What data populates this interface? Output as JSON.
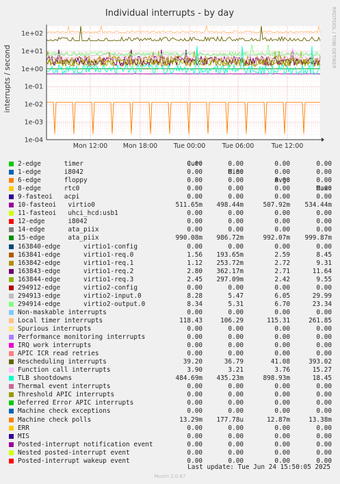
{
  "chart_data": {
    "type": "line",
    "title": "Individual interrupts - by day",
    "ylabel": "interrupts / second",
    "yscale": "log",
    "ylim": [
      0.0001,
      300
    ],
    "y_ticks": [
      "1e+02",
      "1e+01",
      "1e+00",
      "1e-01",
      "1e-02",
      "1e-03",
      "1e-04"
    ],
    "x_ticks": [
      "Mon 12:00",
      "Mon 18:00",
      "Tue 00:00",
      "Tue 06:00",
      "Tue 12:00"
    ],
    "side_label": "RRDTOOL / TOBI OETIKER",
    "columns": [
      "Cur:",
      "Min:",
      "Avg:",
      "Max:"
    ],
    "series": [
      {
        "name": "2-edge      timer",
        "color": "#00cc00",
        "values": [
          "0.00",
          "0.00",
          "0.00",
          "0.00"
        ]
      },
      {
        "name": "1-edge      i8042",
        "color": "#0066b3",
        "values": [
          "0.00",
          "0.00",
          "0.00",
          "0.00"
        ]
      },
      {
        "name": "6-edge      floppy",
        "color": "#ff8000",
        "values": [
          "0.00",
          "0.00",
          "0.00",
          "0.00"
        ]
      },
      {
        "name": "8-edge      rtc0",
        "color": "#ffcc00",
        "values": [
          "0.00",
          "0.00",
          "0.00",
          "0.00"
        ]
      },
      {
        "name": "9-fasteoi   acpi",
        "color": "#330099",
        "values": [
          "0.00",
          "0.00",
          "0.00",
          "0.00"
        ]
      },
      {
        "name": "10-fasteoi   virtio0",
        "color": "#990099",
        "values": [
          "511.65m",
          "498.44m",
          "507.92m",
          "534.44m"
        ]
      },
      {
        "name": "11-fasteoi   uhci_hcd:usb1",
        "color": "#ccff00",
        "values": [
          "0.00",
          "0.00",
          "0.00",
          "0.00"
        ]
      },
      {
        "name": "12-edge      i8042",
        "color": "#ff0000",
        "values": [
          "0.00",
          "0.00",
          "0.00",
          "0.00"
        ]
      },
      {
        "name": "14-edge      ata_piix",
        "color": "#808080",
        "values": [
          "0.00",
          "0.00",
          "0.00",
          "0.00"
        ]
      },
      {
        "name": "15-edge      ata_piix",
        "color": "#008f00",
        "values": [
          "990.08m",
          "986.72m",
          "992.07m",
          "999.87m"
        ]
      },
      {
        "name": "163840-edge      virtio1-config",
        "color": "#00487d",
        "values": [
          "0.00",
          "0.00",
          "0.00",
          "0.00"
        ]
      },
      {
        "name": "163841-edge      virtio1-req.0",
        "color": "#b35a00",
        "values": [
          "1.56",
          "193.65m",
          "2.59",
          "8.45"
        ]
      },
      {
        "name": "163842-edge      virtio1-req.1",
        "color": "#b38f00",
        "values": [
          "1.12",
          "253.72m",
          "2.72",
          "9.31"
        ]
      },
      {
        "name": "163843-edge      virtio1-req.2",
        "color": "#6b006b",
        "values": [
          "2.80",
          "362.17m",
          "2.71",
          "11.64"
        ]
      },
      {
        "name": "163844-edge      virtio1-req.3",
        "color": "#8fb300",
        "values": [
          "2.45",
          "297.09m",
          "2.42",
          "9.55"
        ]
      },
      {
        "name": "294912-edge      virtio2-config",
        "color": "#b30000",
        "values": [
          "0.00",
          "0.00",
          "0.00",
          "0.00"
        ]
      },
      {
        "name": "294913-edge      virtio2-input.0",
        "color": "#bebebe",
        "values": [
          "8.28",
          "5.47",
          "6.05",
          "29.99"
        ]
      },
      {
        "name": "294914-edge      virtio2-output.0",
        "color": "#80ff80",
        "values": [
          "8.34",
          "5.31",
          "6.70",
          "23.34"
        ]
      },
      {
        "name": "Non-maskable interrupts",
        "color": "#80c9ff",
        "values": [
          "0.00",
          "0.00",
          "0.00",
          "0.00"
        ]
      },
      {
        "name": "Local timer interrupts",
        "color": "#ffc080",
        "values": [
          "118.43",
          "106.29",
          "115.31",
          "261.85"
        ]
      },
      {
        "name": "Spurious interrupts",
        "color": "#ffe680",
        "values": [
          "0.00",
          "0.00",
          "0.00",
          "0.00"
        ]
      },
      {
        "name": "Performance monitoring interrupts",
        "color": "#aa80ff",
        "values": [
          "0.00",
          "0.00",
          "0.00",
          "0.00"
        ]
      },
      {
        "name": "IRQ work interrupts",
        "color": "#ee00cc",
        "values": [
          "0.00",
          "0.00",
          "0.00",
          "0.00"
        ]
      },
      {
        "name": "APIC ICR read retries",
        "color": "#ff8080",
        "values": [
          "0.00",
          "0.00",
          "0.00",
          "0.00"
        ]
      },
      {
        "name": "Rescheduling interrupts",
        "color": "#666600",
        "values": [
          "39.20",
          "36.79",
          "41.08",
          "393.02"
        ]
      },
      {
        "name": "Function call interrupts",
        "color": "#ffbfff",
        "values": [
          "3.90",
          "3.21",
          "3.76",
          "15.27"
        ]
      },
      {
        "name": "TLB shootdowns",
        "color": "#00ffcc",
        "values": [
          "484.69m",
          "435.23m",
          "898.93m",
          "18.45"
        ]
      },
      {
        "name": "Thermal event interrupts",
        "color": "#cc6699",
        "values": [
          "0.00",
          "0.00",
          "0.00",
          "0.00"
        ]
      },
      {
        "name": "Threshold APIC interrupts",
        "color": "#999900",
        "values": [
          "0.00",
          "0.00",
          "0.00",
          "0.00"
        ]
      },
      {
        "name": "Deferred Error APIC interrupts",
        "color": "#00cc00",
        "values": [
          "0.00",
          "0.00",
          "0.00",
          "0.00"
        ]
      },
      {
        "name": "Machine check exceptions",
        "color": "#0066b3",
        "values": [
          "0.00",
          "0.00",
          "0.00",
          "0.00"
        ]
      },
      {
        "name": "Machine check polls",
        "color": "#ff8000",
        "values": [
          "13.29m",
          "177.78u",
          "12.87m",
          "13.38m"
        ]
      },
      {
        "name": "ERR",
        "color": "#ffcc00",
        "values": [
          "0.00",
          "0.00",
          "0.00",
          "0.00"
        ]
      },
      {
        "name": "MIS",
        "color": "#330099",
        "values": [
          "0.00",
          "0.00",
          "0.00",
          "0.00"
        ]
      },
      {
        "name": "Posted-interrupt notification event",
        "color": "#990099",
        "values": [
          "0.00",
          "0.00",
          "0.00",
          "0.00"
        ]
      },
      {
        "name": "Nested posted-interrupt event",
        "color": "#ccff00",
        "values": [
          "0.00",
          "0.00",
          "0.00",
          "0.00"
        ]
      },
      {
        "name": "Posted-interrupt wakeup event",
        "color": "#ff0000",
        "values": [
          "0.00",
          "0.00",
          "0.00",
          "0.00"
        ]
      }
    ]
  },
  "footer": {
    "last_update": "Last update: Tue Jun 24 15:50:05 2025",
    "munin": "Munin 2.0.67"
  }
}
